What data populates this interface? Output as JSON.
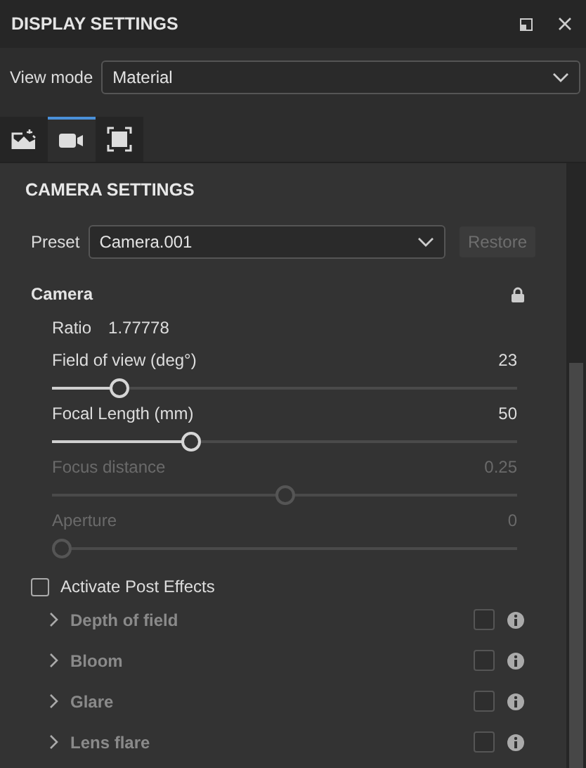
{
  "window": {
    "title": "DISPLAY SETTINGS"
  },
  "view_mode": {
    "label": "View mode",
    "value": "Material"
  },
  "tabs": [
    {
      "kind": "image",
      "selected": false
    },
    {
      "kind": "camera",
      "selected": true
    },
    {
      "kind": "frame",
      "selected": false
    }
  ],
  "section_title": "CAMERA SETTINGS",
  "preset": {
    "label": "Preset",
    "value": "Camera.001",
    "restore_button": "Restore",
    "restore_disabled": true
  },
  "camera": {
    "title": "Camera",
    "locked": true,
    "ratio_label": "Ratio",
    "ratio_value": "1.77778",
    "sliders": [
      {
        "label": "Field of view (deg°)",
        "reading": "23",
        "level": 0.13,
        "disabled": false
      },
      {
        "label": "Focal Length (mm)",
        "reading": "50",
        "level": 0.29,
        "disabled": false
      },
      {
        "label": "Focus distance",
        "reading": "0.25",
        "level": 0.5,
        "disabled": true
      },
      {
        "label": "Aperture",
        "reading": "0",
        "level": 0,
        "disabled": true
      }
    ]
  },
  "post_effects": {
    "label": "Activate Post Effects",
    "checked": false,
    "items": [
      {
        "name": "Depth of field",
        "checked": false,
        "expanded": false
      },
      {
        "name": "Bloom",
        "checked": false,
        "expanded": false
      },
      {
        "name": "Glare",
        "checked": false,
        "expanded": false
      },
      {
        "name": "Lens flare",
        "checked": false,
        "expanded": false
      }
    ]
  }
}
